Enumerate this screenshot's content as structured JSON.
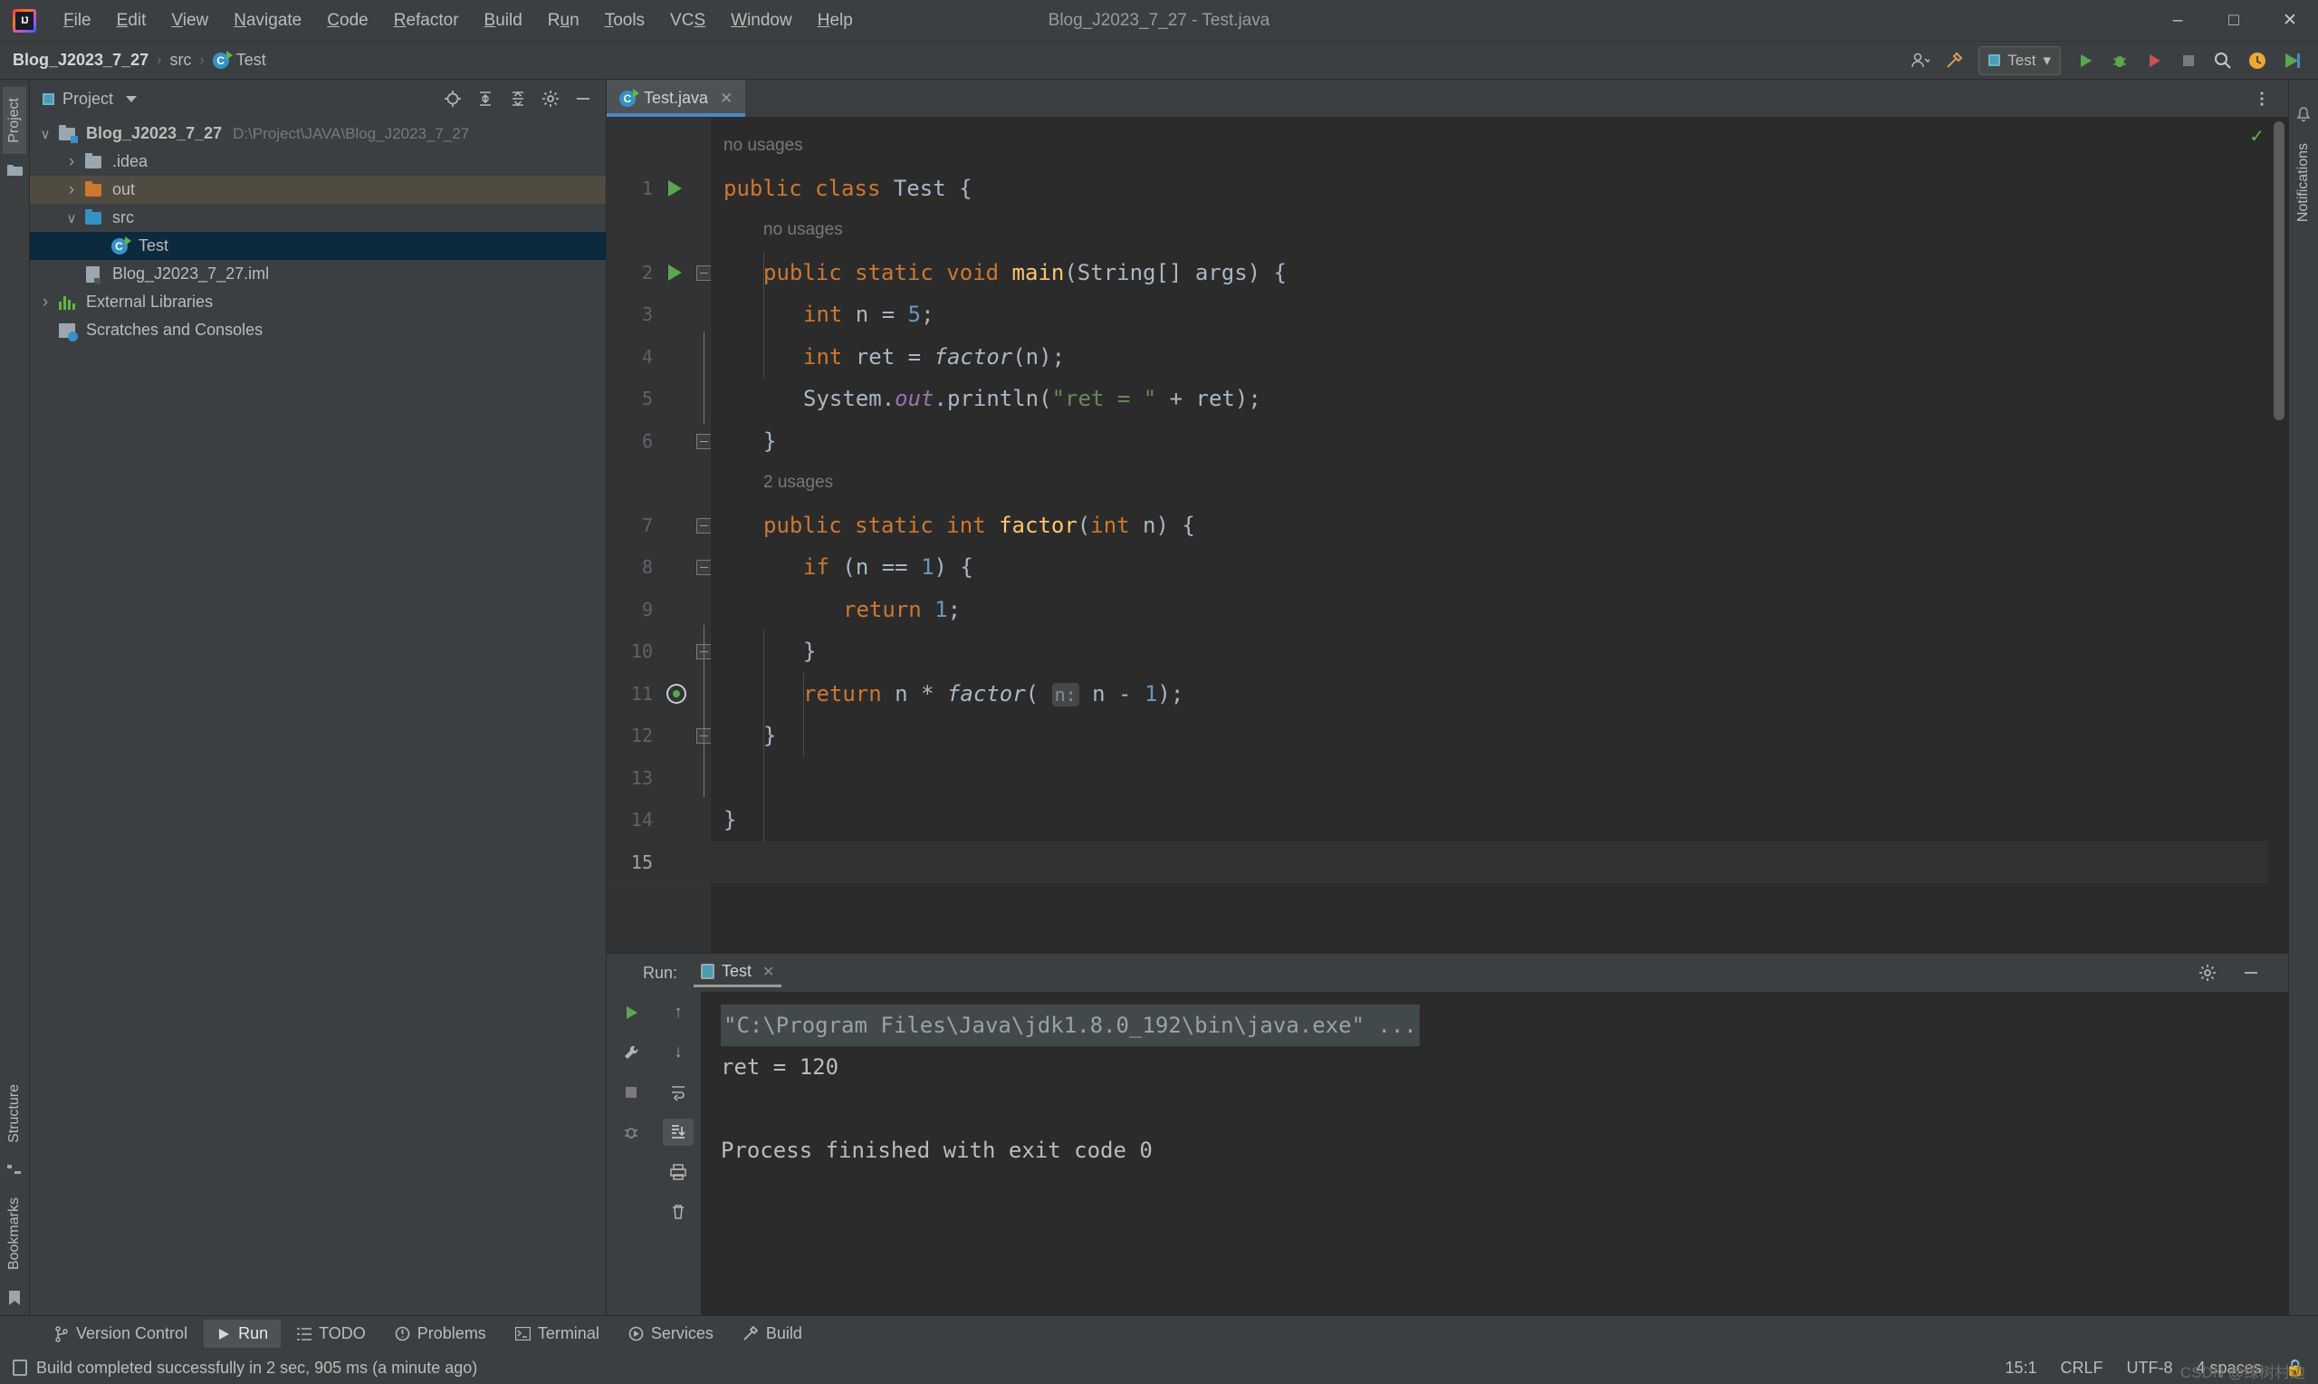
{
  "window": {
    "title": "Blog_J2023_7_27 - Test.java",
    "minimize_label": "–",
    "maximize_label": "□",
    "close_label": "✕"
  },
  "menu": [
    {
      "label": "File",
      "mnemonic": "F"
    },
    {
      "label": "Edit",
      "mnemonic": "E"
    },
    {
      "label": "View",
      "mnemonic": "V"
    },
    {
      "label": "Navigate",
      "mnemonic": "N"
    },
    {
      "label": "Code",
      "mnemonic": "C"
    },
    {
      "label": "Refactor",
      "mnemonic": "R"
    },
    {
      "label": "Build",
      "mnemonic": "B"
    },
    {
      "label": "Run",
      "mnemonic": "u"
    },
    {
      "label": "Tools",
      "mnemonic": "T"
    },
    {
      "label": "VCS",
      "mnemonic": "S"
    },
    {
      "label": "Window",
      "mnemonic": "W"
    },
    {
      "label": "Help",
      "mnemonic": "H"
    }
  ],
  "breadcrumb": {
    "project": "Blog_J2023_7_27",
    "sep1": "›",
    "src": "src",
    "sep2": "›",
    "file": "Test"
  },
  "toolbar": {
    "run_config": "Test",
    "config_caret": "▾",
    "user_icon": "user-icon",
    "hammer_icon": "build-icon",
    "run_icon": "run-icon",
    "debug_icon": "debug-icon",
    "coverage_icon": "coverage-icon",
    "stop_icon": "stop-icon",
    "search_icon": "search-icon",
    "update_icon": "update-icon",
    "ide_icon": "ide-icon"
  },
  "left_strip": {
    "project_tab": "Project",
    "structure_tab": "Structure",
    "bookmarks_tab": "Bookmarks"
  },
  "right_strip": {
    "notifications_tab": "Notifications"
  },
  "project_panel": {
    "title": "Project",
    "caret": "▾",
    "header_icons": [
      "locate-icon",
      "expand-all-icon",
      "collapse-all-icon",
      "settings-icon",
      "hide-icon"
    ],
    "tree": [
      {
        "label": "Blog_J2023_7_27",
        "path": "D:\\Project\\JAVA\\Blog_J2023_7_27",
        "icon": "module-folder-icon",
        "arrow": "open",
        "indent": 0,
        "bold": true,
        "state": "normal"
      },
      {
        "label": ".idea",
        "path": "",
        "icon": "folder-icon",
        "arrow": "closed",
        "indent": 1,
        "bold": false,
        "state": "normal"
      },
      {
        "label": "out",
        "path": "",
        "icon": "folder-orange-icon",
        "arrow": "closed",
        "indent": 1,
        "bold": false,
        "state": "out"
      },
      {
        "label": "src",
        "path": "",
        "icon": "folder-blue-icon",
        "arrow": "open",
        "indent": 1,
        "bold": false,
        "state": "normal"
      },
      {
        "label": "Test",
        "path": "",
        "icon": "java-class-icon",
        "arrow": "none",
        "indent": 2,
        "bold": false,
        "state": "selected"
      },
      {
        "label": "Blog_J2023_7_27.iml",
        "path": "",
        "icon": "iml-file-icon",
        "arrow": "none",
        "indent": 1,
        "bold": false,
        "state": "normal"
      },
      {
        "label": "External Libraries",
        "path": "",
        "icon": "libraries-icon",
        "arrow": "closed",
        "indent": 0,
        "bold": false,
        "state": "normal"
      },
      {
        "label": "Scratches and Consoles",
        "path": "",
        "icon": "scratches-icon",
        "arrow": "none",
        "indent": 0,
        "bold": false,
        "state": "normal"
      }
    ]
  },
  "editor": {
    "tab": {
      "label": "Test.java",
      "close": "✕",
      "icon": "java-class-icon"
    },
    "inspection_status": "✓",
    "hints": {
      "class_usage": "no usages",
      "main_usage": "no usages",
      "factor_usage": "2 usages"
    },
    "lines": [
      {
        "no": 1,
        "text": "public class Test {"
      },
      {
        "no": 2,
        "text": "public static void main(String[] args) {"
      },
      {
        "no": 3,
        "text": "int n = 5;"
      },
      {
        "no": 4,
        "text": "int ret = factor(n);"
      },
      {
        "no": 5,
        "text": "System.out.println(\"ret = \" + ret);"
      },
      {
        "no": 6,
        "text": "}"
      },
      {
        "no": 7,
        "text": "public static int factor(int n) {"
      },
      {
        "no": 8,
        "text": "if (n == 1) {"
      },
      {
        "no": 9,
        "text": "return 1;"
      },
      {
        "no": 10,
        "text": "}"
      },
      {
        "no": 11,
        "text": "return n * factor( n: n - 1);"
      },
      {
        "no": 12,
        "text": "}"
      },
      {
        "no": 13,
        "text": ""
      },
      {
        "no": 14,
        "text": "}"
      },
      {
        "no": 15,
        "text": ""
      }
    ],
    "param_hint": "n:"
  },
  "run_window": {
    "label": "Run:",
    "tab": "Test",
    "tab_close": "✕",
    "settings_icon": "gear-icon",
    "hide_icon": "hide-icon",
    "side_icons": [
      "rerun-icon",
      "up-icon",
      "wrench-icon",
      "down-icon",
      "stop-icon",
      "soft-wrap-icon",
      "trash-icon",
      "scroll-to-end-icon",
      "print-icon"
    ],
    "console": [
      {
        "text": "\"C:\\Program Files\\Java\\jdk1.8.0_192\\bin\\java.exe\" ...",
        "style": "cmd"
      },
      {
        "text": "ret = 120",
        "style": "plain"
      },
      {
        "text": "",
        "style": "plain"
      },
      {
        "text": "Process finished with exit code 0",
        "style": "plain"
      }
    ]
  },
  "bottom_tabs": [
    {
      "label": "Version Control",
      "icon": "branch-icon",
      "active": false
    },
    {
      "label": "Run",
      "icon": "run-icon",
      "active": true
    },
    {
      "label": "TODO",
      "icon": "todo-icon",
      "active": false
    },
    {
      "label": "Problems",
      "icon": "problems-icon",
      "active": false
    },
    {
      "label": "Terminal",
      "icon": "terminal-icon",
      "active": false
    },
    {
      "label": "Services",
      "icon": "services-icon",
      "active": false
    },
    {
      "label": "Build",
      "icon": "build-icon",
      "active": false
    }
  ],
  "status_bar": {
    "message": "Build completed successfully in 2 sec, 905 ms (a minute ago)",
    "caret_position": "15:1",
    "line_separator": "CRLF",
    "encoding": "UTF-8",
    "indent": "4 spaces",
    "lock_icon": "lock-icon",
    "watermark": "CSDN @绿树村边"
  }
}
